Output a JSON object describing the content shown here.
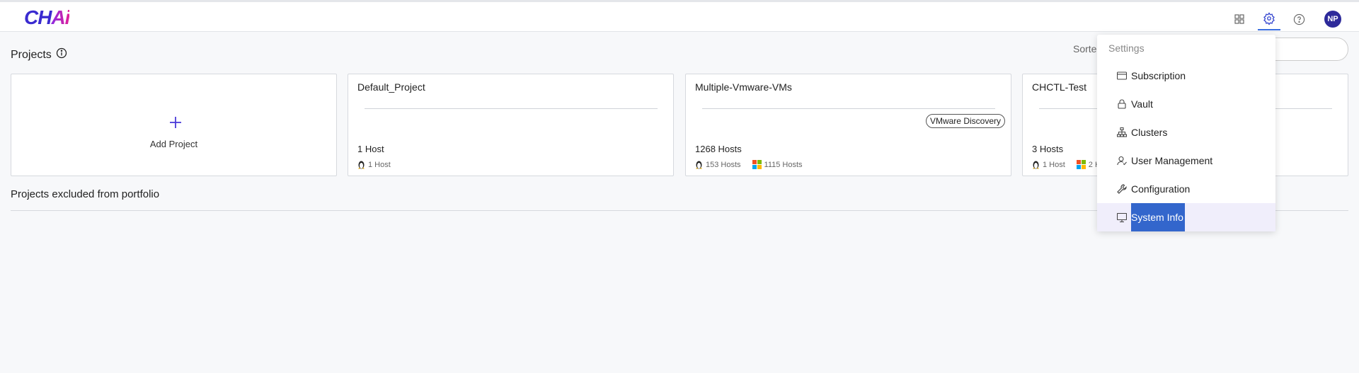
{
  "app": {
    "logo_main": "CH",
    "logo_accent": "Ai"
  },
  "header": {
    "avatar_initials": "NP",
    "icons": [
      "grid-icon",
      "gear-icon",
      "help-icon"
    ]
  },
  "page": {
    "title": "Projects",
    "sort_label": "Sorte",
    "excluded_title": "Projects excluded from portfolio"
  },
  "add_project": {
    "label": "Add Project"
  },
  "projects": [
    {
      "name": "Default_Project",
      "hosts": "1 Host",
      "linux": "1 Host",
      "windows": null,
      "badge": null
    },
    {
      "name": "Multiple-Vmware-VMs",
      "hosts": "1268 Hosts",
      "linux": "153 Hosts",
      "windows": "1115 Hosts",
      "badge": "VMware Discovery"
    },
    {
      "name": "CHCTL-Test",
      "hosts": "3 Hosts",
      "linux": "1 Host",
      "windows": "2 H",
      "badge": null
    }
  ],
  "settings_menu": {
    "title": "Settings",
    "items": [
      {
        "label": "Subscription",
        "icon": "card-icon"
      },
      {
        "label": "Vault",
        "icon": "lock-icon"
      },
      {
        "label": "Clusters",
        "icon": "cluster-icon"
      },
      {
        "label": "User Management",
        "icon": "users-icon"
      },
      {
        "label": "Configuration",
        "icon": "wrench-icon"
      },
      {
        "label": "System Info",
        "icon": "monitor-icon"
      }
    ],
    "selected": "System Info"
  },
  "colors": {
    "accent": "#3366cc",
    "brand": "#3a2bd0",
    "avatar": "#2d2a9a"
  }
}
